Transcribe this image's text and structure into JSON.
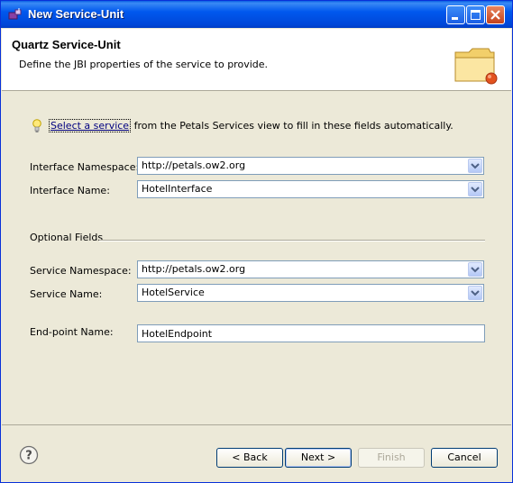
{
  "window": {
    "title": "New Service-Unit"
  },
  "header": {
    "title": "Quartz Service-Unit",
    "description": "Define the JBI properties of the service to provide."
  },
  "hint": {
    "link": "Select a service",
    "rest": " from the Petals Services view to fill in these fields automatically."
  },
  "fields": {
    "interface_namespace": {
      "label": "Interface Namespace:",
      "value": "http://petals.ow2.org"
    },
    "interface_name": {
      "label": "Interface Name:",
      "value": "HotelInterface"
    },
    "optional_group": "Optional Fields",
    "service_namespace": {
      "label": "Service Namespace:",
      "value": "http://petals.ow2.org"
    },
    "service_name": {
      "label": "Service Name:",
      "value": "HotelService"
    },
    "endpoint_name": {
      "label": "End-point Name:",
      "value": "HotelEndpoint"
    }
  },
  "buttons": {
    "back": "< Back",
    "next": "Next >",
    "finish": "Finish",
    "cancel": "Cancel"
  },
  "icons": {
    "app": "wizard-app-icon",
    "folder": "folder-icon",
    "hint": "lightbulb-icon",
    "help": "help-icon"
  }
}
